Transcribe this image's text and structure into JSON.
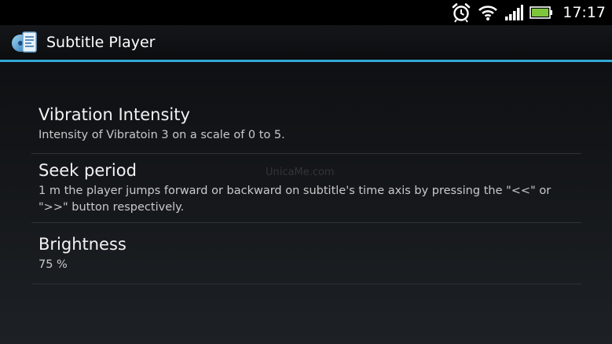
{
  "status_bar": {
    "time": "17:17",
    "icons": [
      "alarm-clock-icon",
      "wifi-icon",
      "signal-icon",
      "battery-icon"
    ]
  },
  "action_bar": {
    "title": "Subtitle Player",
    "icon": "subtitle-player-app-icon"
  },
  "preferences": [
    {
      "title": "Vibration Intensity",
      "summary": "Intensity of Vibratoin 3 on a scale of 0 to 5."
    },
    {
      "title": "Seek period",
      "summary": "1 m the player jumps forward or backward on subtitle's time axis by pressing the \"<<\" or \">>\" button respectively."
    },
    {
      "title": "Brightness",
      "summary": "75 %"
    }
  ],
  "watermark": "UnicaMe.com",
  "colors": {
    "accent": "#33a9d6",
    "battery": "#7ec53b",
    "background": "#121417"
  }
}
